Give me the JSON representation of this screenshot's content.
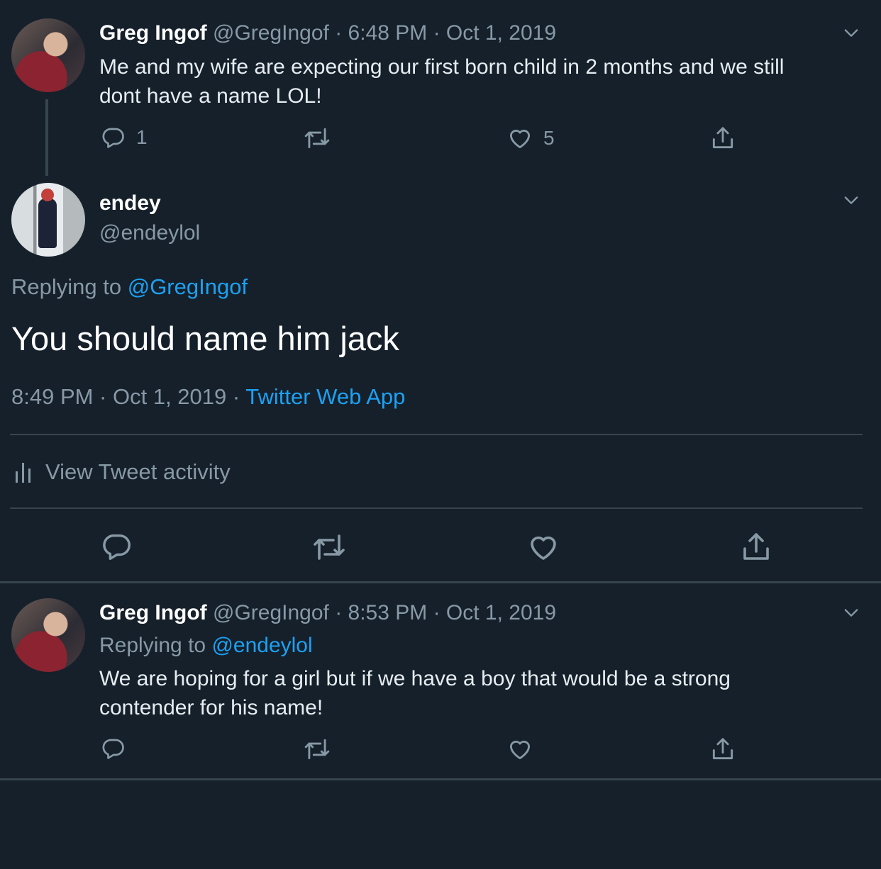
{
  "tweet1": {
    "name": "Greg Ingof",
    "meta": "@GregIngof · 6:48 PM · Oct 1, 2019",
    "line1": "Me and my wife are expecting our first born child in 2 months and we still",
    "line2": "dont have a name LOL!",
    "reply_count": "1",
    "like_count": "5"
  },
  "main": {
    "name": "endey",
    "handle": "@endeylol",
    "replying_prefix": "Replying to",
    "replying_handle": "@GregIngof",
    "text": "You should name him jack",
    "timestamp": "8:49 PM · Oct 1, 2019 ·",
    "source": "Twitter Web App",
    "activity_label": "View Tweet activity"
  },
  "tweet3": {
    "name": "Greg Ingof",
    "meta": "@GregIngof · 8:53 PM · Oct 1, 2019",
    "replying_prefix": "Replying to",
    "replying_handle": "@endeylol",
    "line1": "We are hoping for a girl but if we have a boy that would be a strong",
    "line2": "contender for his name!"
  },
  "icons": [
    "reply-icon",
    "retweet-icon",
    "like-icon",
    "share-icon",
    "chevron-down-icon",
    "activity-icon"
  ],
  "colors": {
    "background": "#15202b",
    "link": "#1da1f2",
    "muted": "#8899a6",
    "text": "#e6ecf0",
    "divider": "#38444d"
  }
}
